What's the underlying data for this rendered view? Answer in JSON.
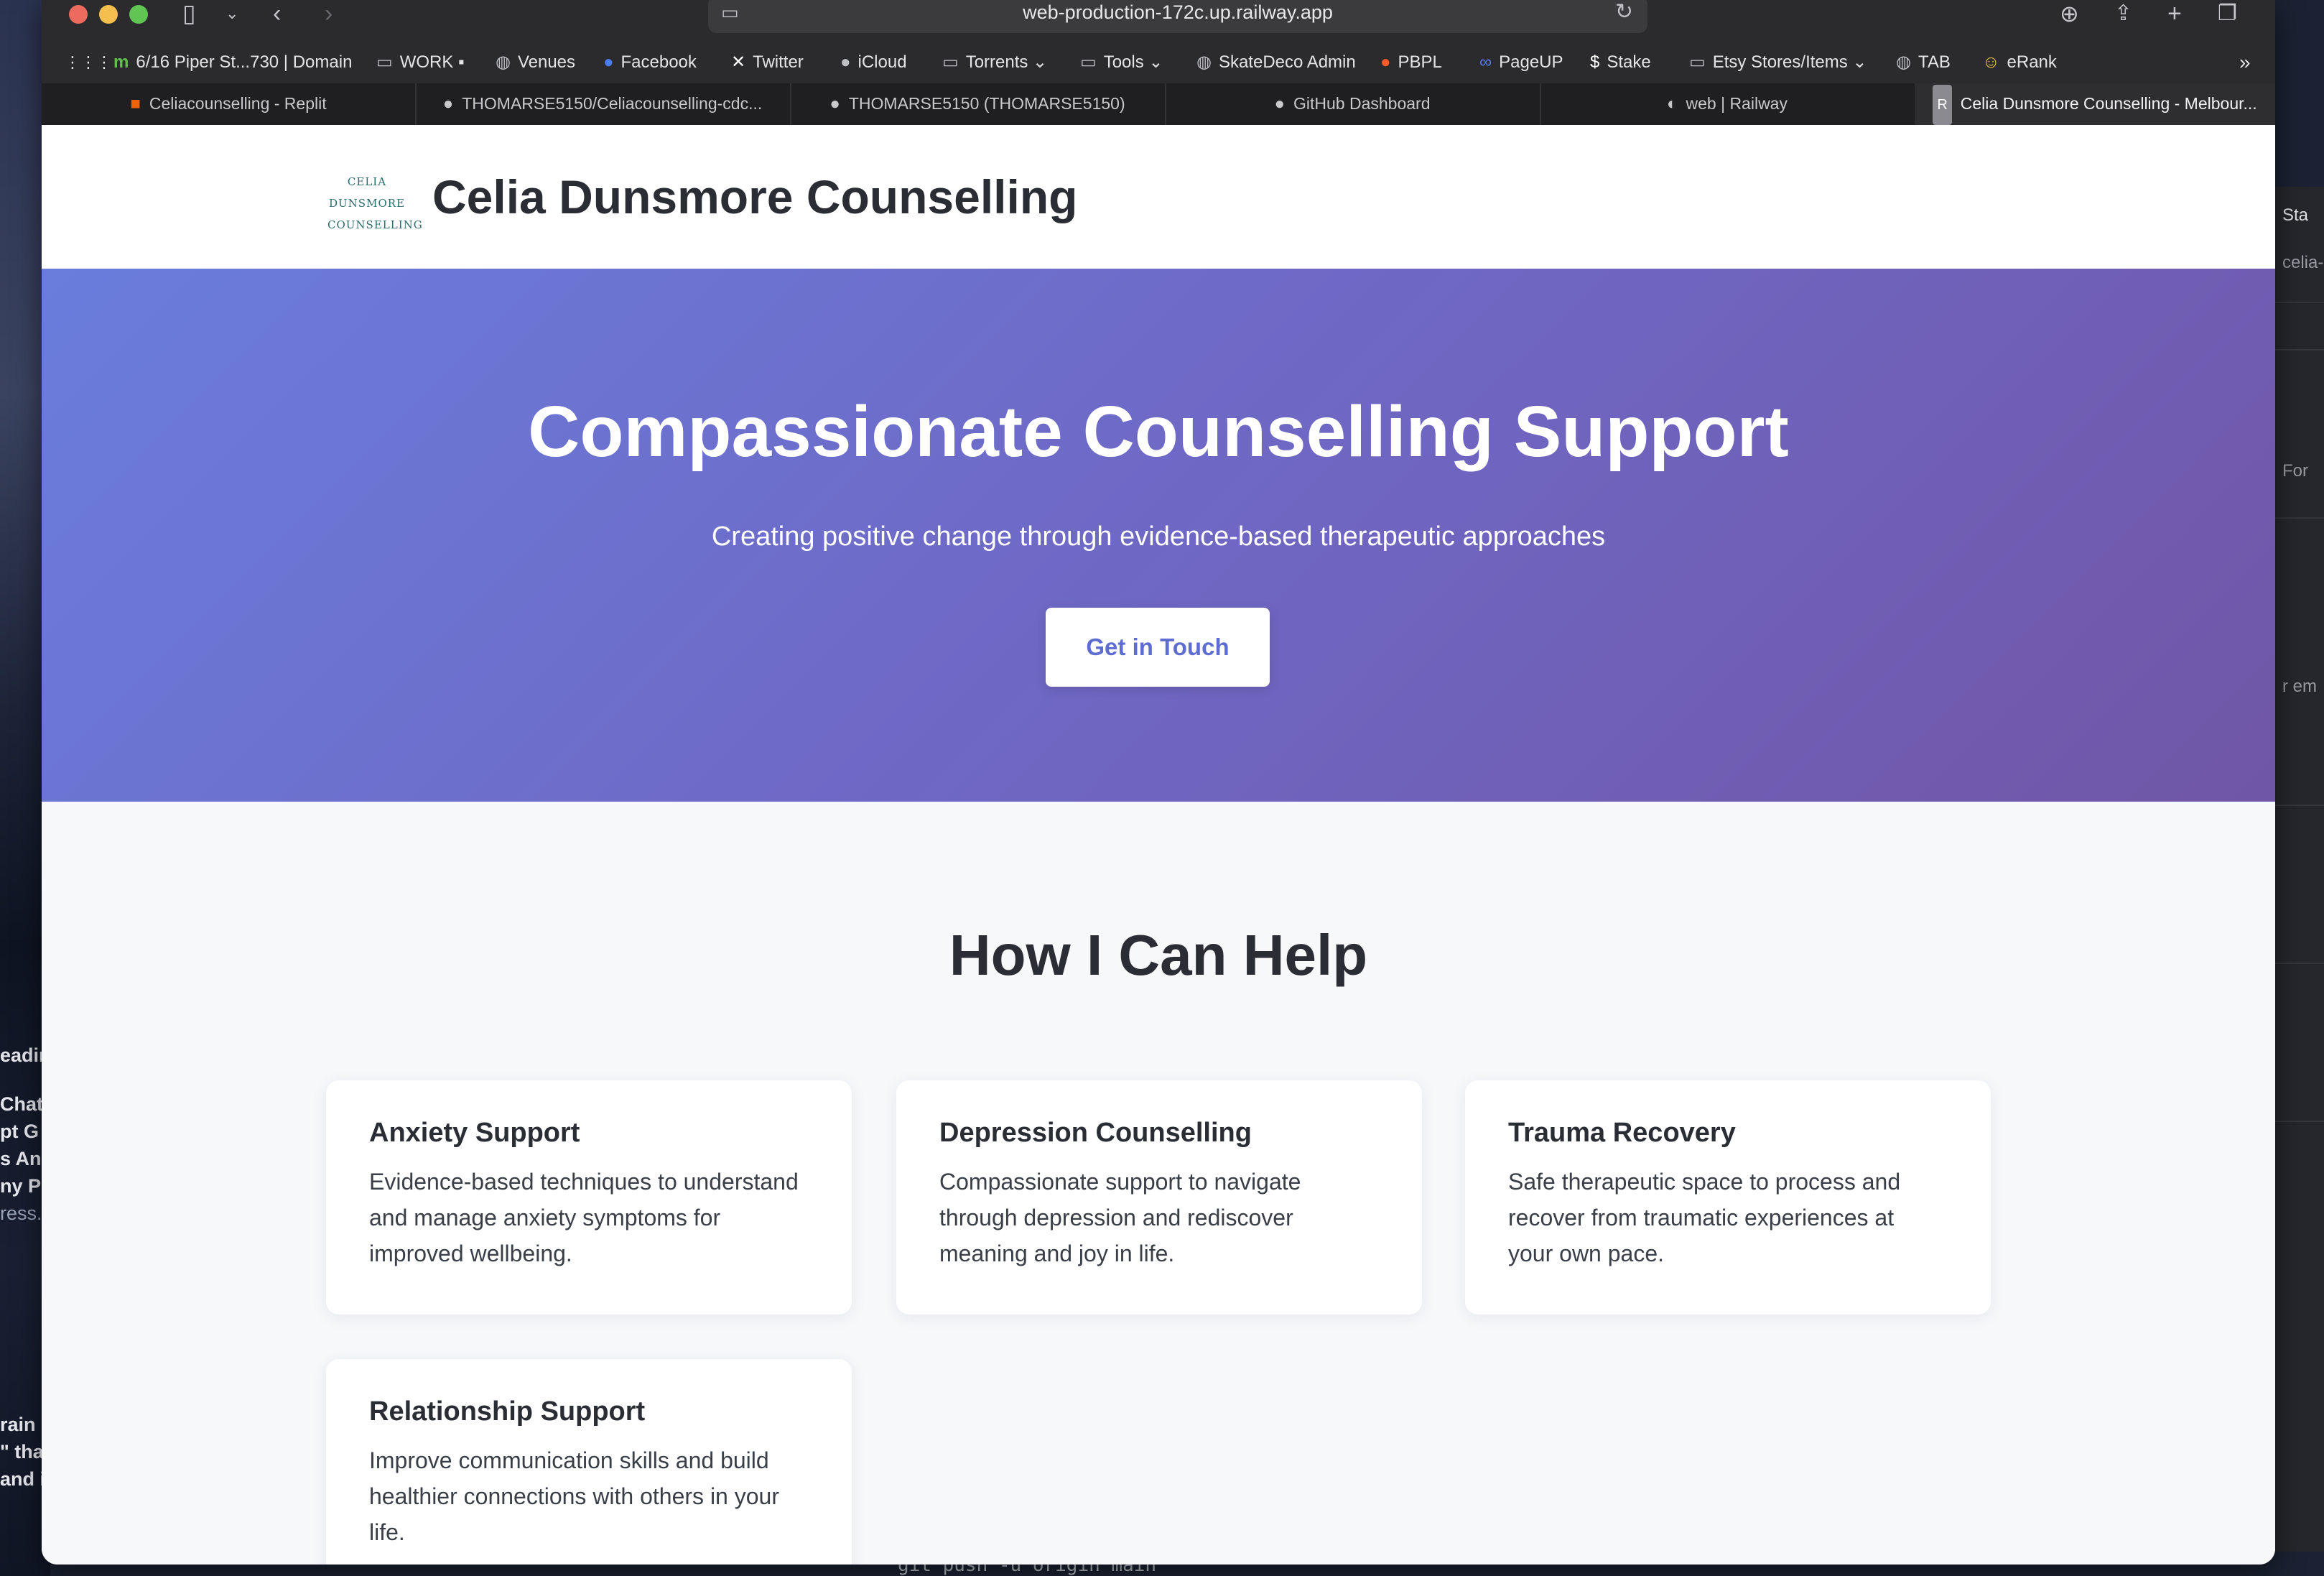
{
  "browser": {
    "url": "web-production-172c.up.railway.app",
    "bookmarks": [
      {
        "label": "6/16 Piper St...730 | Domain",
        "icon": "domain-icon"
      },
      {
        "label": "WORK",
        "icon": "folder-icon"
      },
      {
        "label": "Venues",
        "icon": "globe-icon"
      },
      {
        "label": "Facebook",
        "icon": "facebook-icon"
      },
      {
        "label": "Twitter",
        "icon": "twitter-x-icon"
      },
      {
        "label": "iCloud",
        "icon": "apple-icon"
      },
      {
        "label": "Torrents",
        "icon": "folder-icon"
      },
      {
        "label": "Tools",
        "icon": "folder-icon"
      },
      {
        "label": "SkateDeco Admin",
        "icon": "globe-icon"
      },
      {
        "label": "PBPL",
        "icon": "reddit-icon"
      },
      {
        "label": "PageUP",
        "icon": "pageup-icon"
      },
      {
        "label": "Stake",
        "icon": "stake-icon"
      },
      {
        "label": "Etsy Stores/Items",
        "icon": "folder-icon"
      },
      {
        "label": "TAB",
        "icon": "globe-icon"
      },
      {
        "label": "eRank",
        "icon": "emoji-icon"
      }
    ],
    "tabs": [
      {
        "label": "Celiacounselling - Replit",
        "icon": "replit-icon"
      },
      {
        "label": "THOMARSE5150/Celiacounselling-cdc...",
        "icon": "github-icon"
      },
      {
        "label": "THOMARSE5150 (THOMARSE5150)",
        "icon": "github-icon"
      },
      {
        "label": "GitHub Dashboard",
        "icon": "github-icon"
      },
      {
        "label": "web | Railway",
        "icon": "railway-icon"
      },
      {
        "label": "Celia Dunsmore Counselling - Melbour...",
        "icon": "r-icon"
      }
    ]
  },
  "site": {
    "logo_text_line1": "CELIA DUNSMORE",
    "logo_text_line2": "COUNSELLING",
    "brand": "Celia Dunsmore Counselling",
    "hero": {
      "title": "Compassionate Counselling Support",
      "subtitle": "Creating positive change through evidence-based therapeutic approaches",
      "cta": "Get in Touch"
    },
    "services_title": "How I Can Help",
    "services": [
      {
        "title": "Anxiety Support",
        "text": "Evidence-based techniques to understand and manage anxiety symptoms for improved wellbeing."
      },
      {
        "title": "Depression Counselling",
        "text": "Compassionate support to navigate through depression and rediscover meaning and joy in life."
      },
      {
        "title": "Trauma Recovery",
        "text": "Safe therapeutic space to process and recover from traumatic experiences at your own pace."
      },
      {
        "title": "Relationship Support",
        "text": "Improve communication skills and build healthier connections with others in your life."
      }
    ]
  },
  "desktop": {
    "left_fragments": [
      "eadin",
      "Chat",
      "pt G",
      "s An",
      "ny P",
      "ress.",
      "rain",
      "\" tha",
      "and i"
    ],
    "right_fragments": [
      "Sta",
      "celia-",
      "For",
      "r em"
    ],
    "terminal_text": "git push -u origin main"
  },
  "colors": {
    "hero_start": "#6a7ddc",
    "hero_end": "#7056a6",
    "cta_text": "#5d6dd2",
    "brand_text": "#2a2d33"
  }
}
